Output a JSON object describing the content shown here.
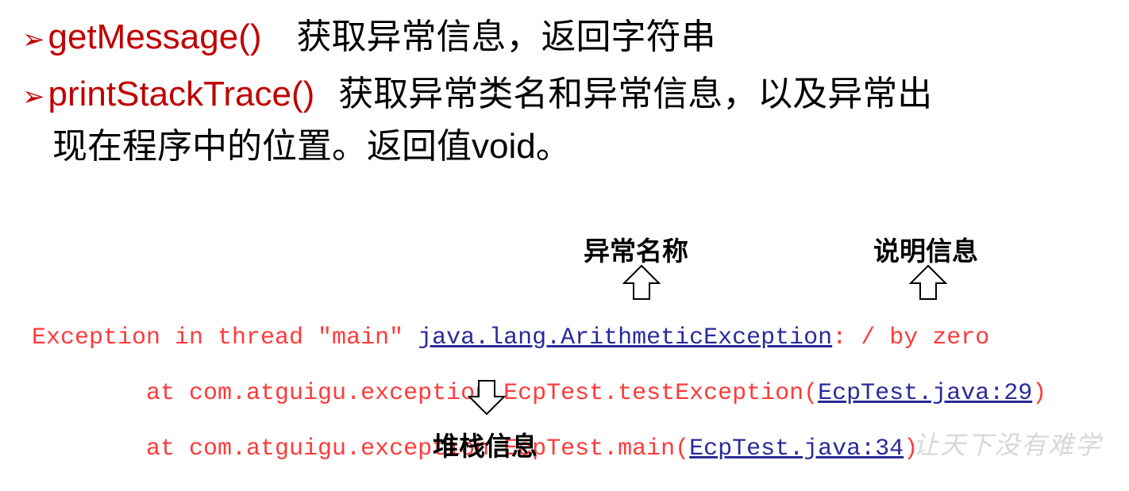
{
  "bullets": [
    {
      "fn": "getMessage()",
      "desc": "获取异常信息，返回字符串"
    },
    {
      "fn": "printStackTrace()",
      "desc": "获取异常类名和异常信息，以及异常出",
      "desc2": "现在程序中的位置。返回值void。"
    }
  ],
  "console": {
    "line1_prefix": "Exception in thread \"main\" ",
    "line1_link": "java.lang.ArithmeticException",
    "line1_suffix": ": / by zero",
    "line2_prefix": "        at com.atguigu.exception.EcpTest.testException(",
    "line2_link": "EcpTest.java:29",
    "line2_suffix": ")",
    "line3_prefix": "        at com.atguigu.exception.EcpTest.main(",
    "line3_link": "EcpTest.java:34",
    "line3_suffix": ")"
  },
  "labels": {
    "exception_name": "异常名称",
    "message": "说明信息",
    "stack": "堆栈信息"
  },
  "watermark": "让天下没有难学",
  "colors": {
    "fn_red": "#c00000",
    "console_red": "#ff3a3a",
    "link_blue": "#2a2a9a"
  }
}
